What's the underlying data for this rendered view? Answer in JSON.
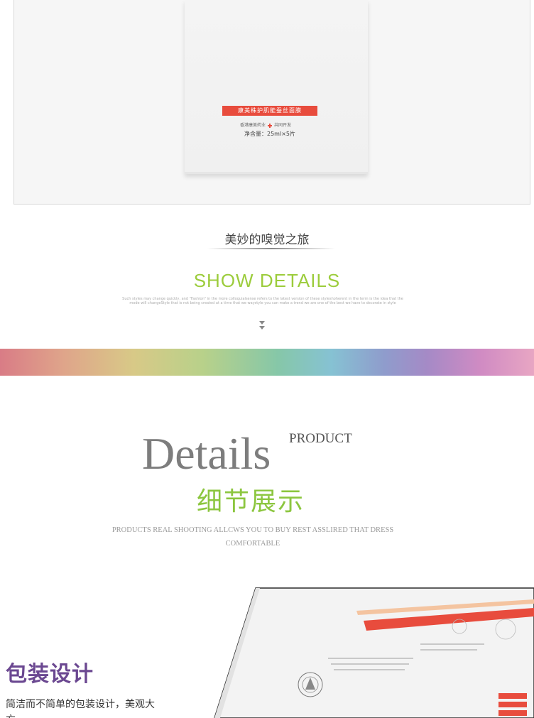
{
  "product_box": {
    "label": "康美株护肌能蚕丝面膜",
    "company": "香港康美药业",
    "company_suffix": "共同开发",
    "net_content": "净含量：25ml×5片"
  },
  "journey": {
    "title": "美妙的嗅觉之旅",
    "show_details": "SHOW DETAILS",
    "description": "Such styles may change quickly, and \"Fashion\" in the more colloquialsense refers to the latest version of these styleshoherent in the term is the idea that the mode will changeStyle that is not being created at a time that we waystyle you can make a trend we are one of the best we have to decorate in style"
  },
  "details": {
    "word": "Details",
    "product": "PRODUCT",
    "cn": "细节展示",
    "sub": "PRODUCTS REAL SHOOTING ALLCWS YOU TO BUY REST ASSLIRED THAT DRESS COMFORTABLE"
  },
  "packaging": {
    "title": "包装设计",
    "description": "简洁而不简单的包装设计，美观大方"
  },
  "colors": {
    "accent_green": "#9ccc3c",
    "title_purple": "#6b4891",
    "label_red": "#e84c3d"
  }
}
